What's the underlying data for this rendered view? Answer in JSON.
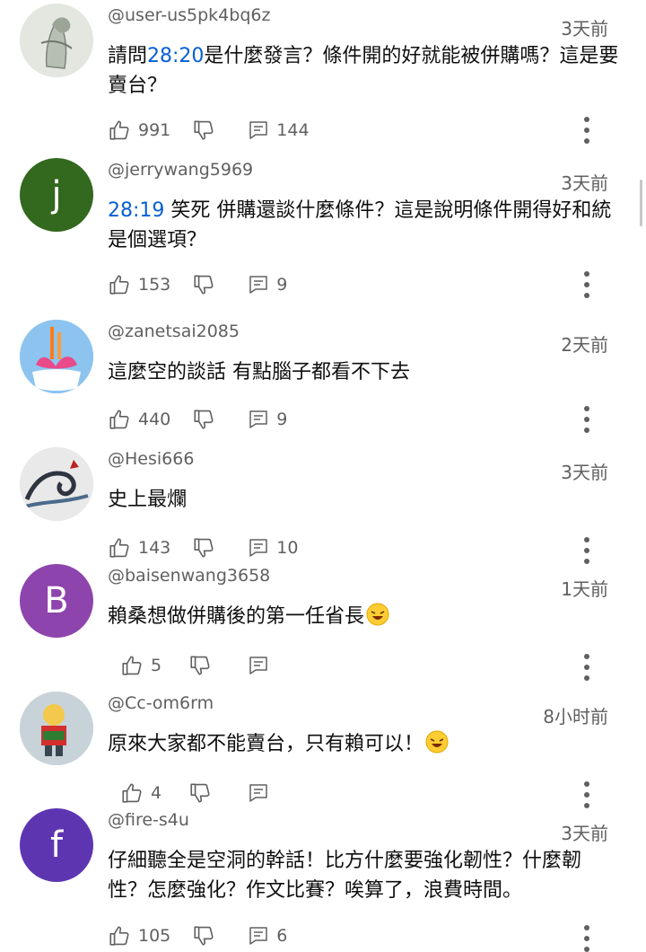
{
  "comments": [
    {
      "handle": "@user-us5pk4bq6z",
      "time": "3天前",
      "ts": "28:20",
      "text_before": "請問",
      "text_after": "是什麼發言？條件開的好就能被併購嗎？這是要賣台？",
      "likes": "991",
      "replies": "144"
    },
    {
      "handle": "@jerrywang5969",
      "time": "3天前",
      "ts": "28:19",
      "text_before": "",
      "text_after": " 笑死 併購還談什麼條件？這是說明條件開得好和統是個選項？",
      "likes": "153",
      "replies": "9"
    },
    {
      "handle": "@zanetsai2085",
      "time": "2天前",
      "text": "這麼空的談話 有點腦子都看不下去",
      "likes": "440",
      "replies": "9"
    },
    {
      "handle": "@Hesi666",
      "time": "3天前",
      "text": "史上最爛",
      "likes": "143",
      "replies": "10"
    },
    {
      "handle": "@baisenwang3658",
      "time": "1天前",
      "avatar_letter": "B",
      "text": "賴桑想做併購後的第一任省長",
      "likes": "5",
      "replies": ""
    },
    {
      "handle": "@Cc-om6rm",
      "time": "8小时前",
      "text": "原來大家都不能賣台，只有賴可以！",
      "likes": "4",
      "replies": ""
    },
    {
      "handle": "@fire-s4u",
      "time": "3天前",
      "avatar_letter": "f",
      "text": "仔細聽全是空洞的幹話！比方什麼要強化韌性？什麼韌性？怎麼強化？作文比賽？唉算了，浪費時間。",
      "likes": "105",
      "replies": "6"
    }
  ],
  "avatar_j_letter": "j",
  "colors": {
    "avatar_j": "#33691e",
    "avatar_b": "#8e44ad",
    "avatar_f": "#5e35b1",
    "timestamp_link": "#065fd4",
    "secondary_text": "#606060"
  },
  "icons": [
    "thumb-up-icon",
    "thumb-down-icon",
    "reply-icon",
    "more-vert-icon",
    "laughing-emoji-icon"
  ]
}
